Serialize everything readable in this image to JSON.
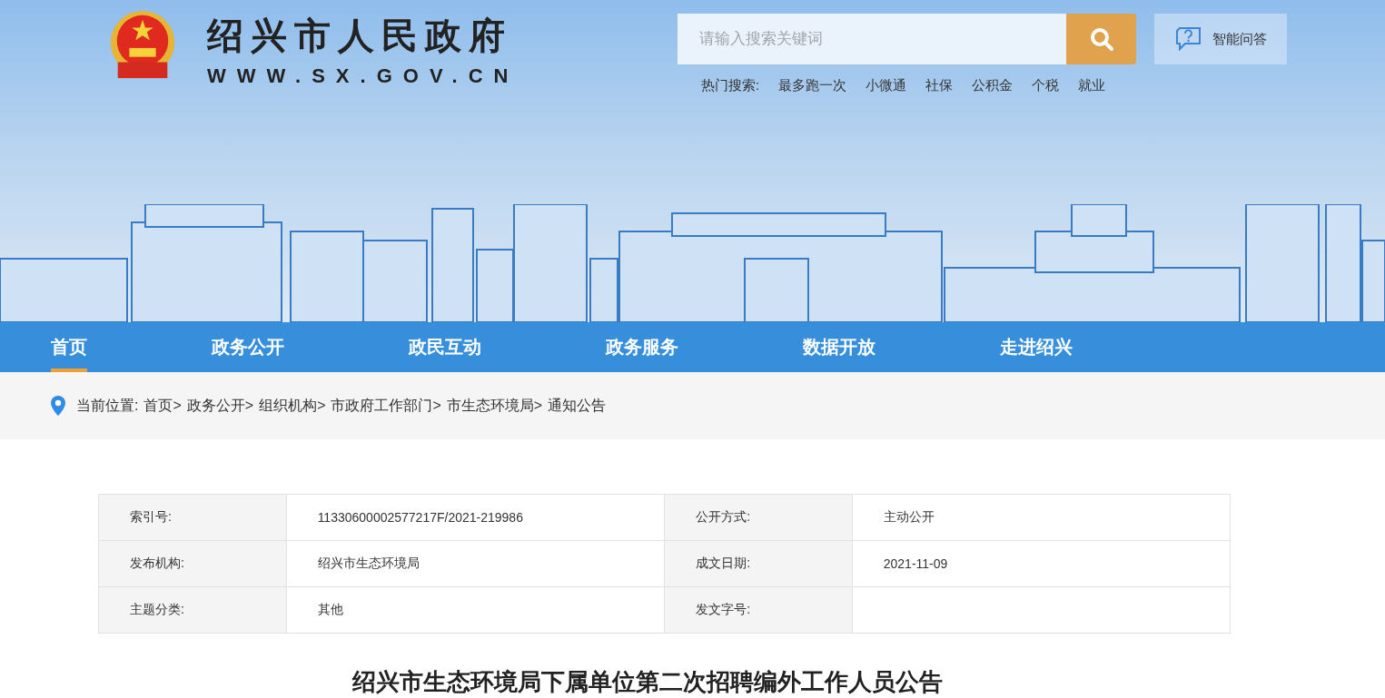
{
  "site": {
    "title": "绍兴市人民政府",
    "domain": "WWW.SX.GOV.CN"
  },
  "search": {
    "placeholder": "请输入搜索关键词"
  },
  "qa_button": {
    "label": "智能问答"
  },
  "hot_search": {
    "label": "热门搜索:",
    "items": [
      "最多跑一次",
      "小微通",
      "社保",
      "公积金",
      "个税",
      "就业"
    ]
  },
  "nav": [
    {
      "label": "首页",
      "selected": true
    },
    {
      "label": "政务公开",
      "selected": false
    },
    {
      "label": "政民互动",
      "selected": false
    },
    {
      "label": "政务服务",
      "selected": false
    },
    {
      "label": "数据开放",
      "selected": false
    },
    {
      "label": "走进绍兴",
      "selected": false
    }
  ],
  "breadcrumb": {
    "label": "当前位置:",
    "items": [
      "首页>",
      "政务公开>",
      "组织机构>",
      "市政府工作部门>",
      "市生态环境局>",
      "通知公告"
    ]
  },
  "info_table": {
    "rows": [
      [
        {
          "label": "索引号:",
          "value": "11330600002577217F/2021-219986"
        },
        {
          "label": "公开方式:",
          "value": "主动公开"
        }
      ],
      [
        {
          "label": "发布机构:",
          "value": "绍兴市生态环境局"
        },
        {
          "label": "成文日期:",
          "value": "2021-11-09"
        }
      ],
      [
        {
          "label": "主题分类:",
          "value": "其他"
        },
        {
          "label": "发文字号:"
        }
      ]
    ]
  },
  "article": {
    "title": "绍兴市生态环境局下属单位第二次招聘编外工作人员公告"
  }
}
